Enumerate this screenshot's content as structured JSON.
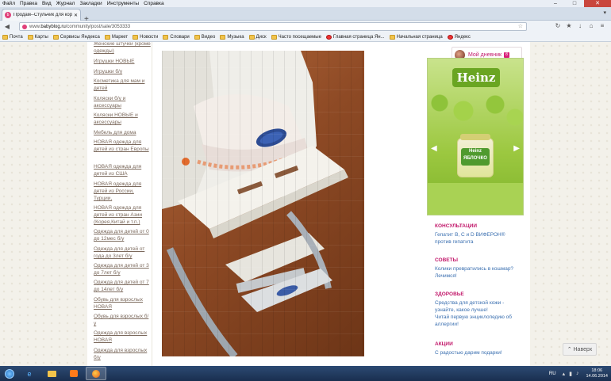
{
  "menubar": [
    "Файл",
    "Правка",
    "Вид",
    "Журнал",
    "Закладки",
    "Инструменты",
    "Справка"
  ],
  "tab": {
    "title": "Продам--Стульчик для корм...",
    "favicon": "b"
  },
  "address": {
    "domain_prefix": "www.",
    "domain": "babyblog.ru",
    "path": "/community/post/sale/3053333"
  },
  "bookmarks": [
    "Почта",
    "Карты",
    "Сервисы Яндекса",
    "Маркет",
    "Новости",
    "Словари",
    "Видео",
    "Музыка",
    "Диск",
    "Часто посещаемые",
    "Главная страница Ян...",
    "Начальная страница",
    "Яндекс"
  ],
  "left_links": [
    "Женские штучки (кроме одежды)",
    "Игрушки НОВЫЕ",
    "Игрушки б/у",
    "Косметика для мам и детей",
    "Коляски б/у и аксессуары",
    "Коляски НОВЫЕ и аксессуары",
    "Мебель для дома",
    "НОВАЯ одежда для детей из стран Европы",
    "НОВАЯ одежда для детей из США",
    "НОВАЯ одежда для детей из России, Турции,",
    "НОВАЯ одежда для детей из стран Азии (Корея,Китай и т.п.)",
    "Одежда для детей от 0 до 12мес б/у",
    "Одежда для детей от года до 3лет б/у",
    "Одежда для детей от 3 до 7лет б/у",
    "Одежда для детей от 7 до 14лет б/у",
    "Обувь для взрослых НОВАЯ",
    "Обувь для взрослых б/у",
    "Одежда для взрослых НОВАЯ",
    "Одежда для взрослых б/у"
  ],
  "my_diary": {
    "label": "Мой дневник",
    "count": "8"
  },
  "banner": {
    "brand": "Heinz",
    "jar_label_1": "Heinz",
    "jar_label_2": "ЯБЛОЧКО"
  },
  "sections": [
    {
      "title": "КОНСУЛЬТАЦИИ",
      "links": [
        "Гепатит В, С и D ВИФЕРОН® против гепатита"
      ]
    },
    {
      "title": "СОВЕТЫ",
      "links": [
        "Колики превратились в кошмар? Лечимся!"
      ]
    },
    {
      "title": "ЗДОРОВЬЕ",
      "links": [
        "Средства для детской кожи - узнайте, какое лучше!",
        "Читай первую энциклопедию об аллергии!"
      ]
    },
    {
      "title": "АКЦИИ",
      "links": [
        "С радостью дарим подарки!"
      ]
    }
  ],
  "up_button": "Наверх",
  "taskbar": {
    "lang": "RU",
    "time": "18:06",
    "date": "14.06.2014"
  }
}
